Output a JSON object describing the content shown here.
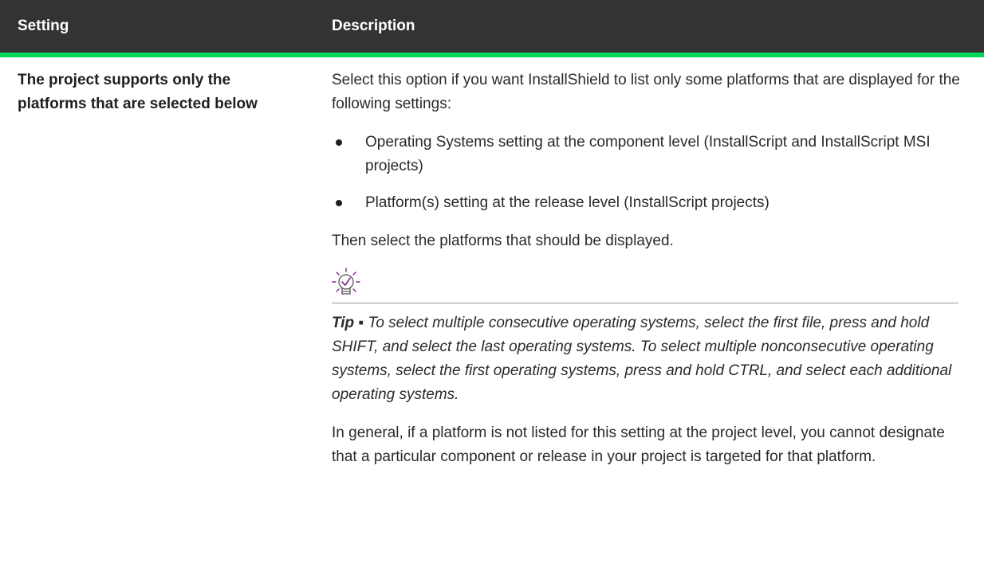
{
  "table": {
    "headers": {
      "setting": "Setting",
      "description": "Description"
    },
    "row": {
      "setting": "The project supports only the platforms that are selected below",
      "intro": "Select this option if you want InstallShield to list only some platforms that are displayed for the following settings:",
      "bullets": [
        "Operating Systems setting at the component level (InstallScript and InstallScript MSI projects)",
        "Platform(s) setting at the release level (InstallScript projects)"
      ],
      "after_bullets": "Then select the platforms that should be displayed.",
      "tip_label": "Tip ▪",
      "tip_text": "To select multiple consecutive operating systems, select the first file, press and hold SHIFT, and select the last operating systems. To select multiple nonconsecutive operating systems, select the first operating systems, press and hold CTRL, and select each additional operating systems.",
      "closing": "In general, if a platform is not listed for this setting at the project level, you cannot designate that a particular component or release in your project is targeted for that platform."
    }
  },
  "colors": {
    "header_bg": "#333333",
    "header_accent": "#00d95a",
    "tip_icon": "#7b2a8c"
  },
  "icons": {
    "tip": "lightbulb-check-icon"
  }
}
